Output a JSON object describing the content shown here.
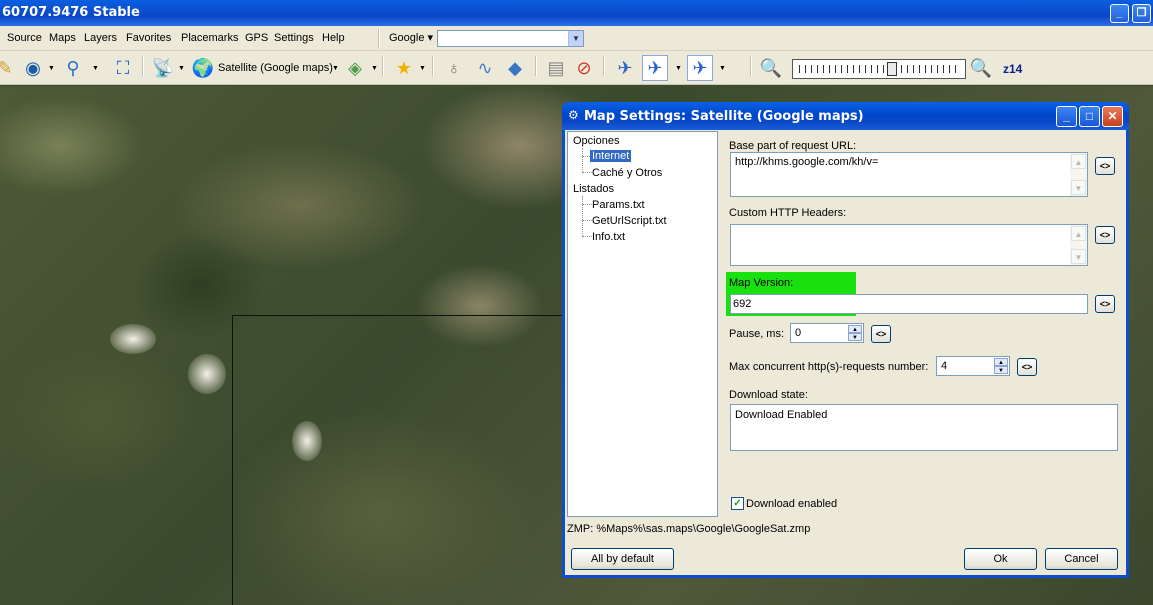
{
  "app": {
    "title": "60707.9476 Stable"
  },
  "menu": {
    "items": [
      "Source",
      "Maps",
      "Layers",
      "Favorites",
      "Placemarks",
      "GPS",
      "Settings",
      "Help"
    ],
    "search_provider": "Google",
    "search_value": ""
  },
  "toolbar": {
    "map_label": "Satellite (Google maps)",
    "zoom_level": "z14",
    "zoom_fraction": 0.58
  },
  "dialog": {
    "title": "Map Settings: Satellite (Google maps)",
    "tree": {
      "opciones": "Opciones",
      "internet": "Internet",
      "cache": "Caché y Otros",
      "listados": "Listados",
      "params": "Params.txt",
      "geturl": "GetUrlScript.txt",
      "info": "Info.txt"
    },
    "base_url_label": "Base part of request URL:",
    "base_url_value": "http://khms.google.com/kh/v=",
    "headers_label": "Custom HTTP Headers:",
    "headers_value": "",
    "map_version_label": "Map Version:",
    "map_version_value": "692",
    "pause_label": "Pause, ms:",
    "pause_value": "0",
    "max_requests_label": "Max concurrent http(s)-requests number:",
    "max_requests_value": "4",
    "download_state_label": "Download state:",
    "download_state_value": "Download Enabled",
    "download_enabled_label": "Download enabled",
    "download_enabled_checked": true,
    "zmp_path": "ZMP:  %Maps%\\sas.maps\\Google\\GoogleSat.zmp",
    "edit_button": "<>",
    "all_default": "All by default",
    "ok": "Ok",
    "cancel": "Cancel"
  },
  "colors": {
    "xp_blue": "#0a47c8",
    "highlight_green": "#19e00f",
    "face": "#ece9d8"
  }
}
